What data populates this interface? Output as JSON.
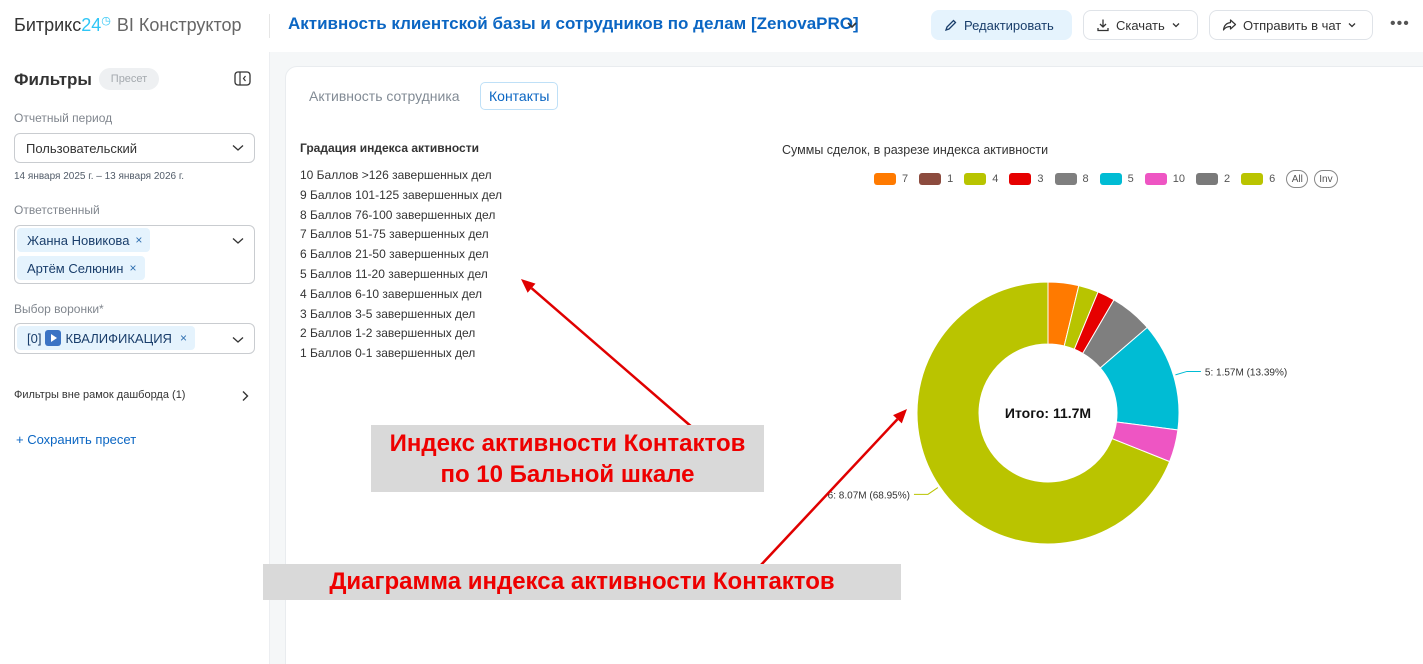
{
  "header": {
    "brand_name": "Битрикс",
    "brand_num": "24",
    "brand_product": "BI Конструктор",
    "dashboard_title": "Активность клиентской базы и сотрудников по делам [ZenovaPRO]",
    "edit_label": "Редактировать",
    "download_label": "Скачать",
    "send_label": "Отправить в чат",
    "more_label": "•••"
  },
  "sidebar": {
    "title": "Фильтры",
    "preset_chip": "Пресет",
    "period_label": "Отчетный период",
    "period_value": "Пользовательский",
    "period_range": "14 января 2025 г. – 13 января 2026 г.",
    "responsible_label": "Ответственный",
    "responsible_tags": [
      "Жанна Новикова",
      "Артём Селюнин"
    ],
    "funnel_label": "Выбор воронки",
    "funnel_required_mark": "*",
    "funnel_tag_prefix": "[0]",
    "funnel_tag_text": "КВАЛИФИКАЦИЯ",
    "tag_remove": "×",
    "outside_filters": "Фильтры вне рамок дашборда (1)",
    "save_preset": "+ Сохранить пресет"
  },
  "tabs": {
    "employee_activity": "Активность сотрудника",
    "contacts": "Контакты"
  },
  "gradation": {
    "title": "Градация индекса активности",
    "items": [
      "10 Баллов >126 завершенных дел",
      "9 Баллов 101-125 завершенных дел",
      "8 Баллов 76-100 завершенных дел",
      "7 Баллов 51-75 завершенных дел",
      "6 Баллов 21-50 завершенных дел",
      "5 Баллов 11-20 завершенных дел",
      "4 Баллов 6-10 завершенных дел",
      "3 Баллов 3-5 завершенных дел",
      "2 Баллов 1-2 завершенных дел",
      "1 Баллов 0-1 завершенных дел"
    ]
  },
  "chart_data": {
    "type": "pie",
    "variant": "donut",
    "title": "Суммы сделок, в разрезе индекса активности",
    "center_label": "Итого: 11.7M",
    "legend_placement": "top",
    "legend": [
      {
        "name": "7",
        "color": "#ff7a00"
      },
      {
        "name": "1",
        "color": "#8c4b3e"
      },
      {
        "name": "4",
        "color": "#b8c400"
      },
      {
        "name": "3",
        "color": "#e60000"
      },
      {
        "name": "8",
        "color": "#7f7f7f"
      },
      {
        "name": "5",
        "color": "#00bcd4"
      },
      {
        "name": "10",
        "color": "#ee55c3"
      },
      {
        "name": "2",
        "color": "#7a7a7a"
      },
      {
        "name": "6",
        "color": "#bac400"
      }
    ],
    "legend_buttons": [
      "All",
      "Inv"
    ],
    "slices": [
      {
        "name": "7",
        "value": 3.78,
        "color": "#ff7a00"
      },
      {
        "name": "4",
        "value": 2.46,
        "color": "#b8c400"
      },
      {
        "name": "3",
        "value": 2.16,
        "color": "#e60000"
      },
      {
        "name": "8",
        "value": 5.28,
        "color": "#7f7f7f"
      },
      {
        "name": "5",
        "value": 13.39,
        "color": "#00bcd4",
        "label": "5: 1.57M (13.39%)"
      },
      {
        "name": "10",
        "value": 3.98,
        "color": "#ee55c3"
      },
      {
        "name": "6",
        "value": 68.95,
        "color": "#bac400",
        "label": "6: 8.07M (68.95%)"
      }
    ]
  },
  "annotations": {
    "index_line1": "Индекс активности Контактов",
    "index_line2": "по 10 Бальной шкале",
    "diagram": "Диаграмма индекса активности Контактов",
    "arrow_color": "#e00000"
  }
}
